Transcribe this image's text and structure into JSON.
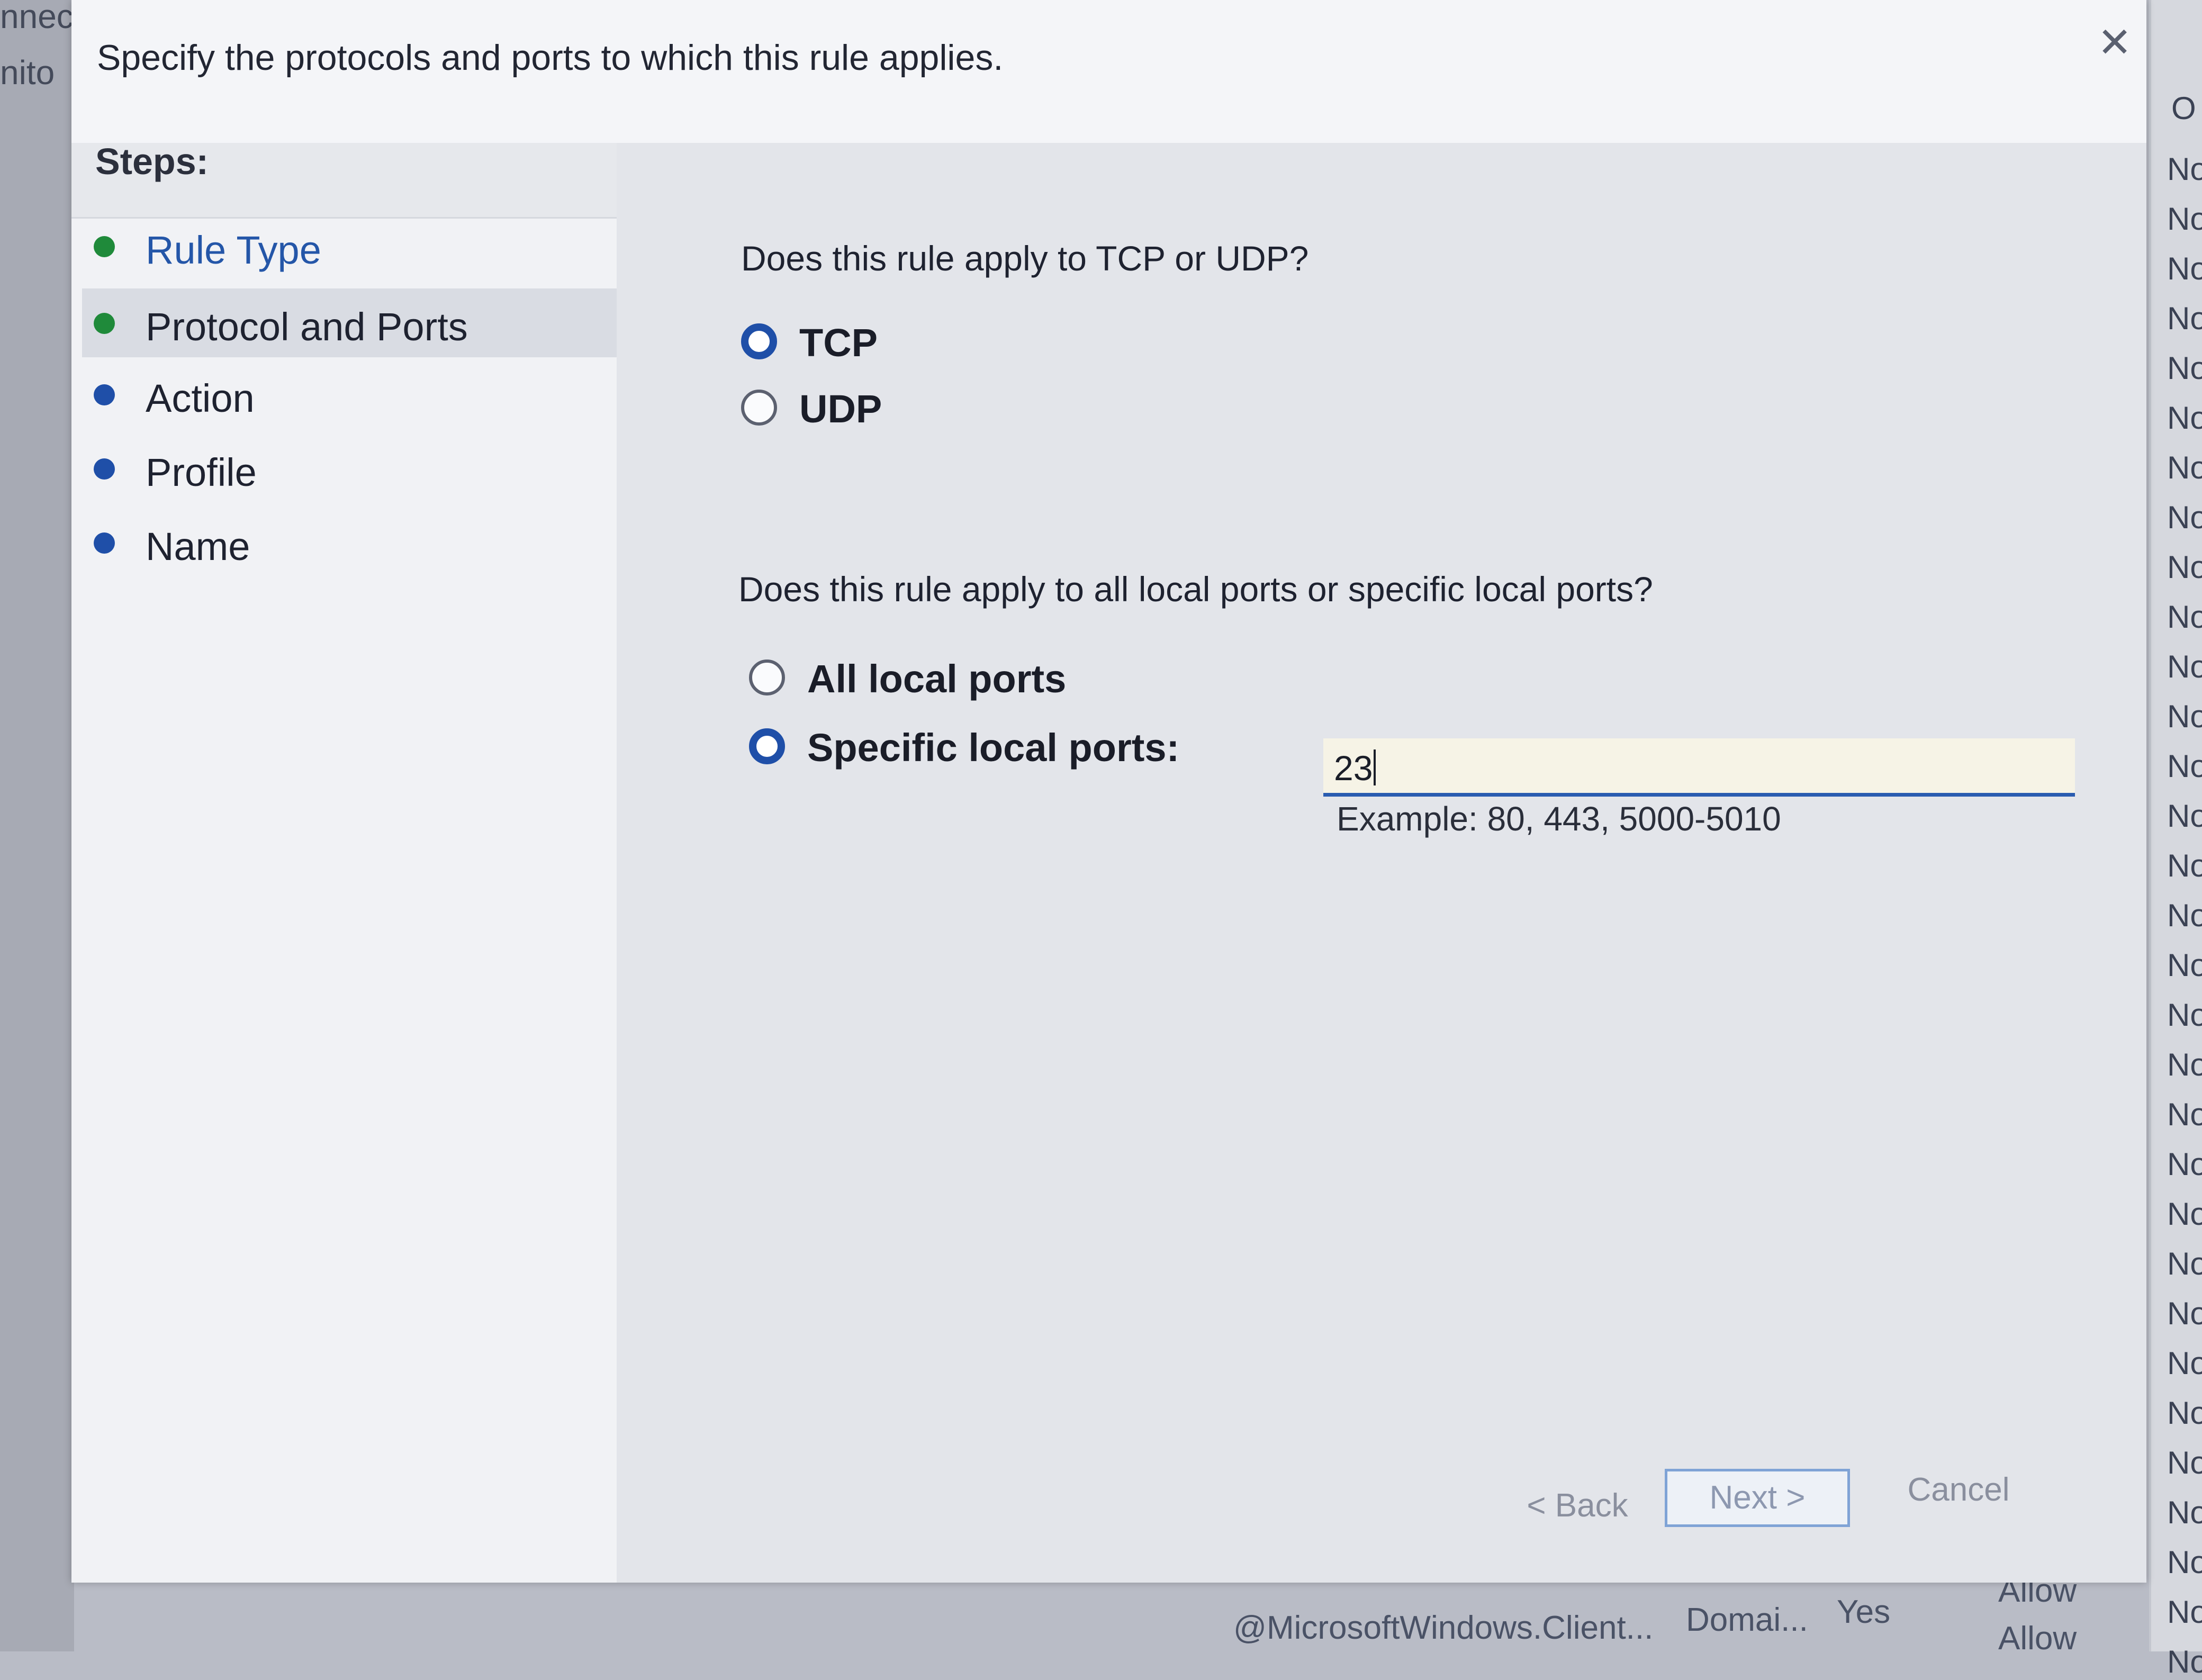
{
  "background_window": {
    "left_fragments": [
      "nnec",
      "nito"
    ],
    "right_column_header": "O",
    "right_column_values": [
      "No",
      "No",
      "No",
      "No",
      "No",
      "No",
      "No",
      "No",
      "No",
      "No",
      "No",
      "No",
      "No",
      "No",
      "No",
      "No",
      "No",
      "No",
      "No",
      "No",
      "No",
      "No",
      "No",
      "No",
      "No",
      "No",
      "No",
      "No",
      "No",
      "No",
      "No"
    ],
    "bottom_row": [
      "@MicrosoftWindows.Client...",
      "Domai...",
      "Yes",
      "Allow"
    ],
    "bottom_row_partial": "Allow"
  },
  "dialog": {
    "header_text": "Specify the protocols and ports to which this rule applies.",
    "close_glyph": "✕",
    "steps": {
      "title": "Steps:",
      "items": [
        {
          "label": "Rule Type",
          "dot_color": "#1f8a3a",
          "label_color": "#2456a8"
        },
        {
          "label": "Protocol and Ports",
          "dot_color": "#1f8a3a",
          "label_color": "#1e2230"
        },
        {
          "label": "Action",
          "dot_color": "#1f4fa8",
          "label_color": "#1e2230"
        },
        {
          "label": "Profile",
          "dot_color": "#1f4fa8",
          "label_color": "#1e2230"
        },
        {
          "label": "Name",
          "dot_color": "#1f4fa8",
          "label_color": "#1e2230"
        }
      ]
    },
    "protocol": {
      "question": "Does this rule apply to TCP or UDP?",
      "options": [
        {
          "label": "TCP",
          "selected": true
        },
        {
          "label": "UDP",
          "selected": false
        }
      ]
    },
    "ports": {
      "question": "Does this rule apply to all local ports or specific local ports?",
      "options": [
        {
          "label": "All local ports",
          "selected": false
        },
        {
          "label": "Specific local ports:",
          "selected": true
        }
      ],
      "input_value": "23",
      "example": "Example: 80, 443, 5000-5010"
    },
    "buttons": {
      "back": "< Back",
      "next": "Next >",
      "cancel": "Cancel"
    }
  },
  "colors": {
    "accent": "#1f4fa8",
    "input_underline": "#2a5cb0",
    "complete_step": "#1f8a3a"
  }
}
